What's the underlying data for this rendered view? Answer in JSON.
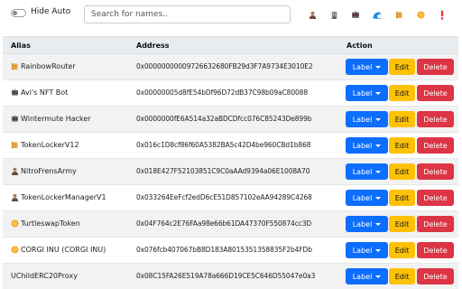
{
  "toolbar": {
    "hide_auto_label": "Hide Auto",
    "search_placeholder": "Search for names..",
    "filter_icons": [
      "person-icon",
      "building-icon",
      "robot-icon",
      "wave-icon",
      "scroll-icon",
      "coin-icon",
      "exclamation-icon"
    ]
  },
  "table": {
    "headers": {
      "alias": "Alias",
      "address": "Address",
      "action": "Action"
    },
    "buttons": {
      "label": "Label",
      "edit": "Edit",
      "delete": "Delete"
    },
    "rows": [
      {
        "icon": "scroll-icon",
        "alias": "RainbowRouter",
        "address": "0x00000000009726632680FB29d3F7A9734E3010E2"
      },
      {
        "icon": "robot-icon",
        "alias": "Avi's NFT Bot",
        "address": "0x00000005d8fE54bDf96D72dB37C98b09aC80088"
      },
      {
        "icon": "robot-icon",
        "alias": "Wintermute Hacker",
        "address": "0x0000000fE6A514a32aBDCDfcc076C85243De899b"
      },
      {
        "icon": "scroll-icon",
        "alias": "TokenLockerV12",
        "address": "0x016c1D8cf86f60A5382BA5c42D4be960CBd1b868"
      },
      {
        "icon": "person-icon",
        "alias": "NitroFrensArmy",
        "address": "0x018E427F52103851C9C0aAAd9394a06E1008A70"
      },
      {
        "icon": "person-icon",
        "alias": "TokenLockerManagerV1",
        "address": "0x033264EeFcf2edD6cE51D857102eAA94289C4268"
      },
      {
        "icon": "coin-icon",
        "alias": "TurtleswapToken",
        "address": "0x04F764c2E76FAa98e66b61DA47370F550874cc3D"
      },
      {
        "icon": "coin-icon",
        "alias": "CORGI INU (CORGI INU)",
        "address": "0x076fcb407067bB8D183A8015351358835F2b4FDb"
      },
      {
        "icon": "",
        "alias": "UChildERC20Proxy",
        "address": "0x08C15FA26E519A78a666D19CE5C646D55047e0a3"
      }
    ]
  },
  "colors": {
    "primary": "#0d6efd",
    "warning": "#ffc107",
    "danger": "#dc3545"
  }
}
